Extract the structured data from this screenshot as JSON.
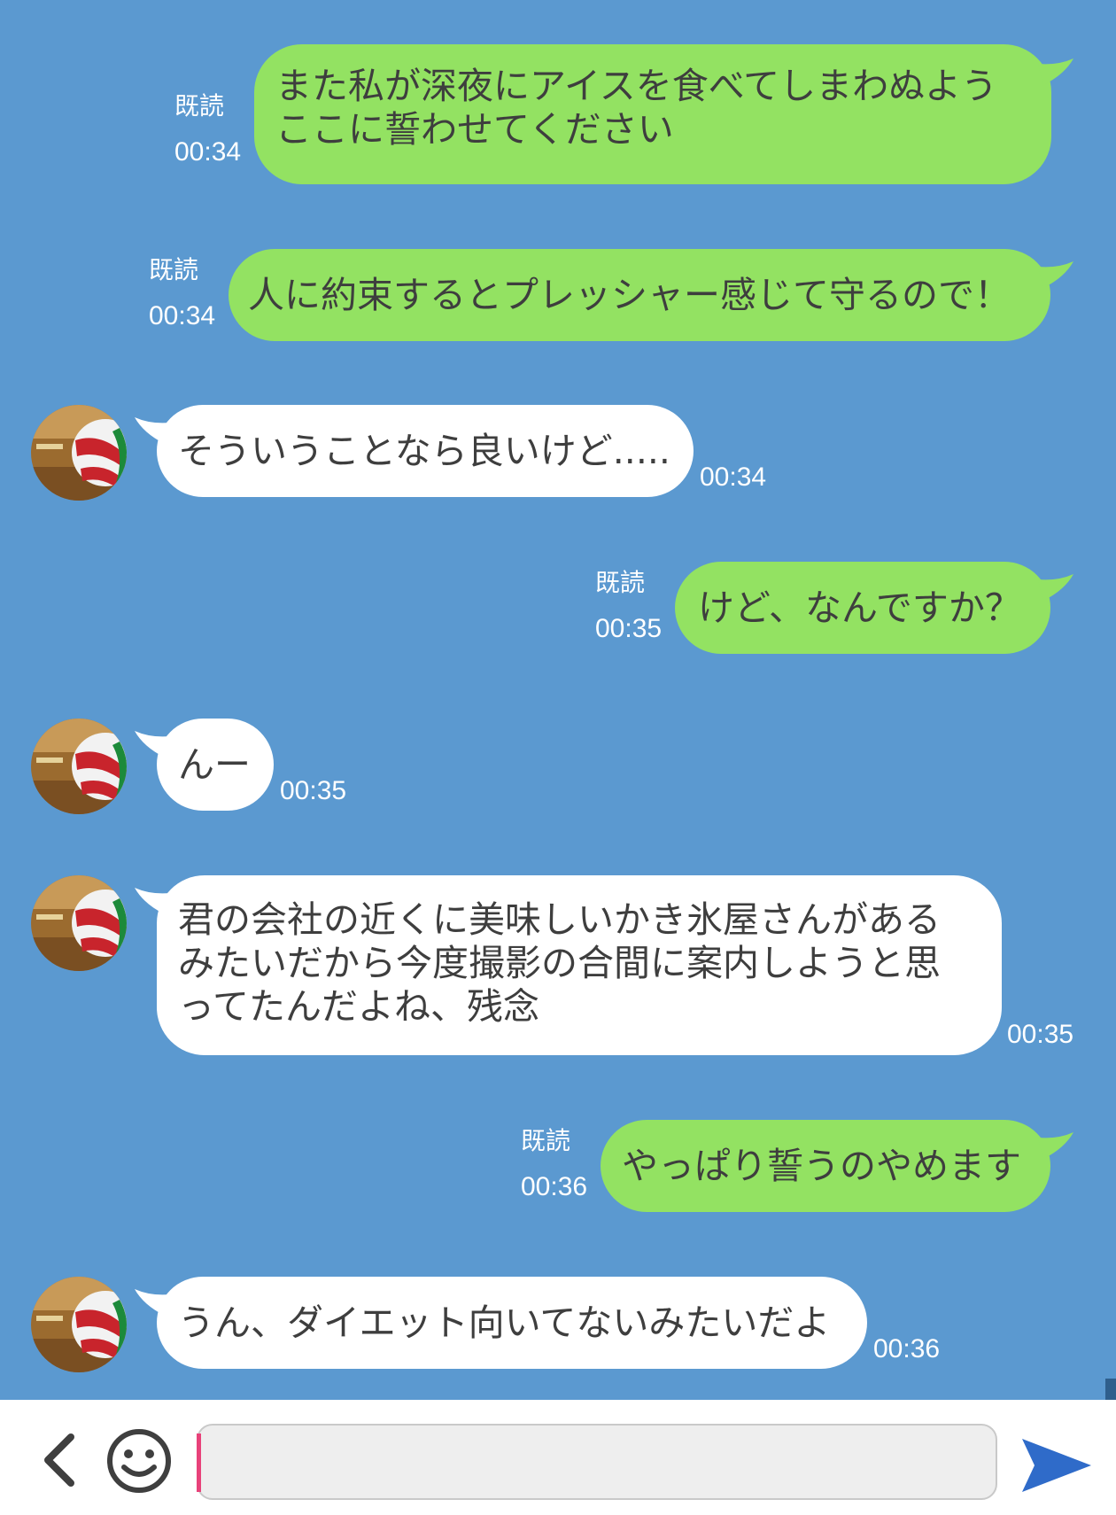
{
  "messages": [
    {
      "side": "out",
      "text": "また私が深夜にアイスを食べてしまわぬよう\nここに誓わせてください",
      "read_label": "既読",
      "time": "00:34"
    },
    {
      "side": "out",
      "text": "人に約束するとプレッシャー感じて守るので！",
      "read_label": "既読",
      "time": "00:34"
    },
    {
      "side": "in",
      "text": "そういうことなら良いけど.....",
      "time": "00:34"
    },
    {
      "side": "out",
      "text": "けど、なんですか？",
      "read_label": "既読",
      "time": "00:35"
    },
    {
      "side": "in",
      "text": "んー",
      "time": "00:35"
    },
    {
      "side": "in",
      "text": "君の会社の近くに美味しいかき氷屋さんがある\nみたいだから今度撮影の合間に案内しようと思\nってたんだよね、残念",
      "time": "00:35"
    },
    {
      "side": "out",
      "text": "やっぱり誓うのやめます",
      "read_label": "既読",
      "time": "00:36"
    },
    {
      "side": "in",
      "text": "うん、ダイエット向いてないみたいだよ",
      "time": "00:36"
    }
  ],
  "input": {
    "placeholder": "",
    "value": ""
  },
  "colors": {
    "background": "#5b99d0",
    "outgoing_bubble": "#93e262",
    "incoming_bubble": "#ffffff",
    "send": "#2f6bc9",
    "caret": "#e8427a"
  },
  "icons": {
    "back": "chevron-left-icon",
    "emoji": "smiley-icon",
    "send": "send-icon",
    "avatar": "volleyball-avatar"
  }
}
